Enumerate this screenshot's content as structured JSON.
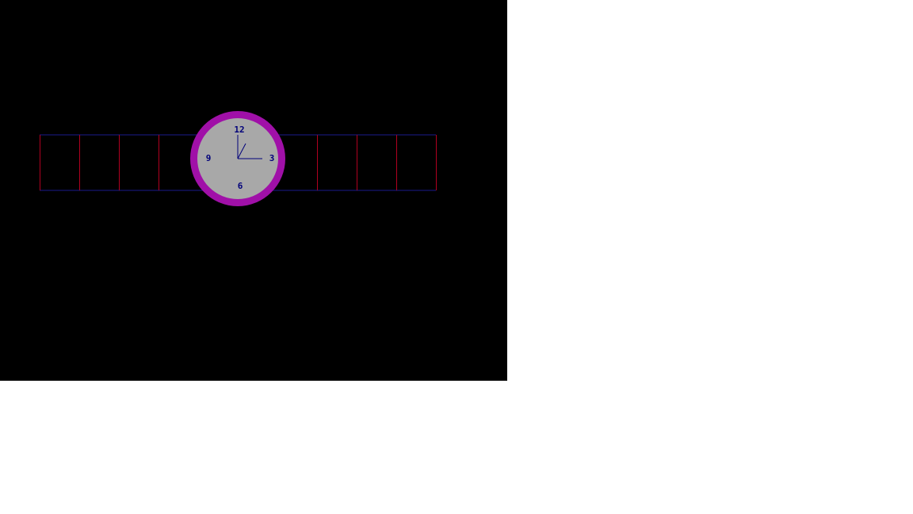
{
  "colors": {
    "background": "#000000",
    "page": "#ffffff",
    "strap_edge": "#1a1a8c",
    "strap_link": "#b00020",
    "case": "#a010a8",
    "dial": "#a8a8a8",
    "numerals": "#00007a",
    "hands": "#00007a"
  },
  "watch": {
    "numerals": {
      "twelve": "12",
      "three": "3",
      "six": "6",
      "nine": "9"
    },
    "time": {
      "hour_hand_icon": "clock-hand-hour",
      "minute_hand_icon": "clock-hand-minute",
      "second_hand_icon": "clock-hand-second"
    }
  }
}
